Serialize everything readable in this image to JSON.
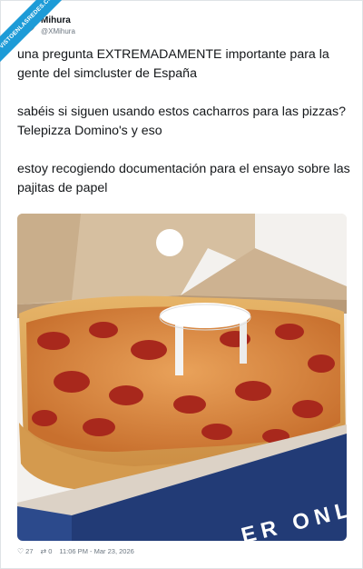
{
  "watermark": "VISTOENLASREDES.COM",
  "author": {
    "name": "Mihura",
    "handle": "@XMihura"
  },
  "tweet": {
    "paragraph_1": "una pregunta EXTREMADAMENTE importante para la gente del simcluster de España",
    "paragraph_2": "sabéis si siguen usando estos cacharros para las pizzas? Telepizza Domino's y eso",
    "paragraph_3": "estoy recogiendo documentación para el ensayo sobre las pajitas de papel"
  },
  "media": {
    "box_print_text": "ER ONLI"
  },
  "footer": {
    "likes": "27",
    "retweets": "0",
    "timestamp": "11:06 PM - Mar 23, 2026"
  },
  "icons": {
    "like": "heart-icon",
    "retweet": "retweet-icon"
  },
  "colors": {
    "watermark_bg": "#1d9bd7",
    "text": "#14171a",
    "muted": "#6b7680"
  }
}
